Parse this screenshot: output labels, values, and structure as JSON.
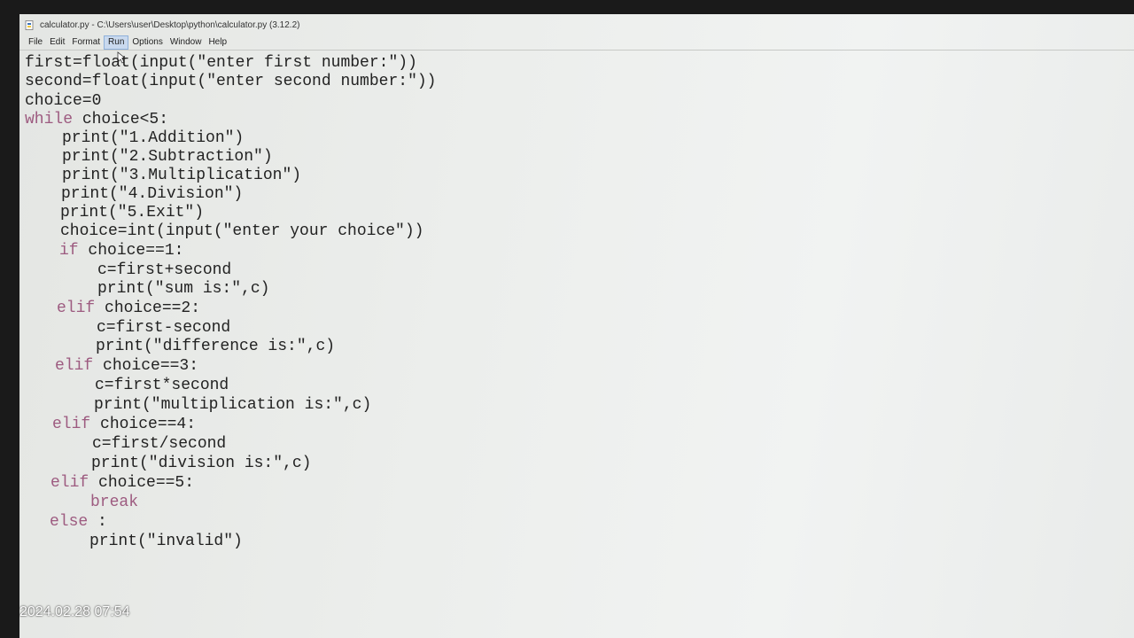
{
  "window": {
    "title": "calculator.py - C:\\Users\\user\\Desktop\\python\\calculator.py (3.12.2)",
    "icon": "python-file-icon"
  },
  "menu": {
    "items": [
      "File",
      "Edit",
      "Format",
      "Run",
      "Options",
      "Window",
      "Help"
    ],
    "active": "Run"
  },
  "code": {
    "lines": [
      "first=float(input(\"enter first number:\"))",
      "second=float(input(\"enter second number:\"))",
      "choice=0",
      "while choice<5:",
      "    print(\"1.Addition\")",
      "    print(\"2.Subtraction\")",
      "    print(\"3.Multiplication\")",
      "    print(\"4.Division\")",
      "    print(\"5.Exit\")",
      "    choice=int(input(\"enter your choice\"))",
      "    if choice==1:",
      "        c=first+second",
      "        print(\"sum is:\",c)",
      "    elif choice==2:",
      "        c=first-second",
      "        print(\"difference is:\",c)",
      "    elif choice==3:",
      "        c=first*second",
      "        print(\"multiplication is:\",c)",
      "    elif choice==4:",
      "        c=first/second",
      "        print(\"division is:\",c)",
      "    elif choice==5:",
      "        break",
      "    else :",
      "        print(\"invalid\")"
    ],
    "keyword_color": "#9d5b80",
    "text_color": "#222222"
  },
  "overlay": {
    "timestamp": "2024.02.28 07:54"
  }
}
